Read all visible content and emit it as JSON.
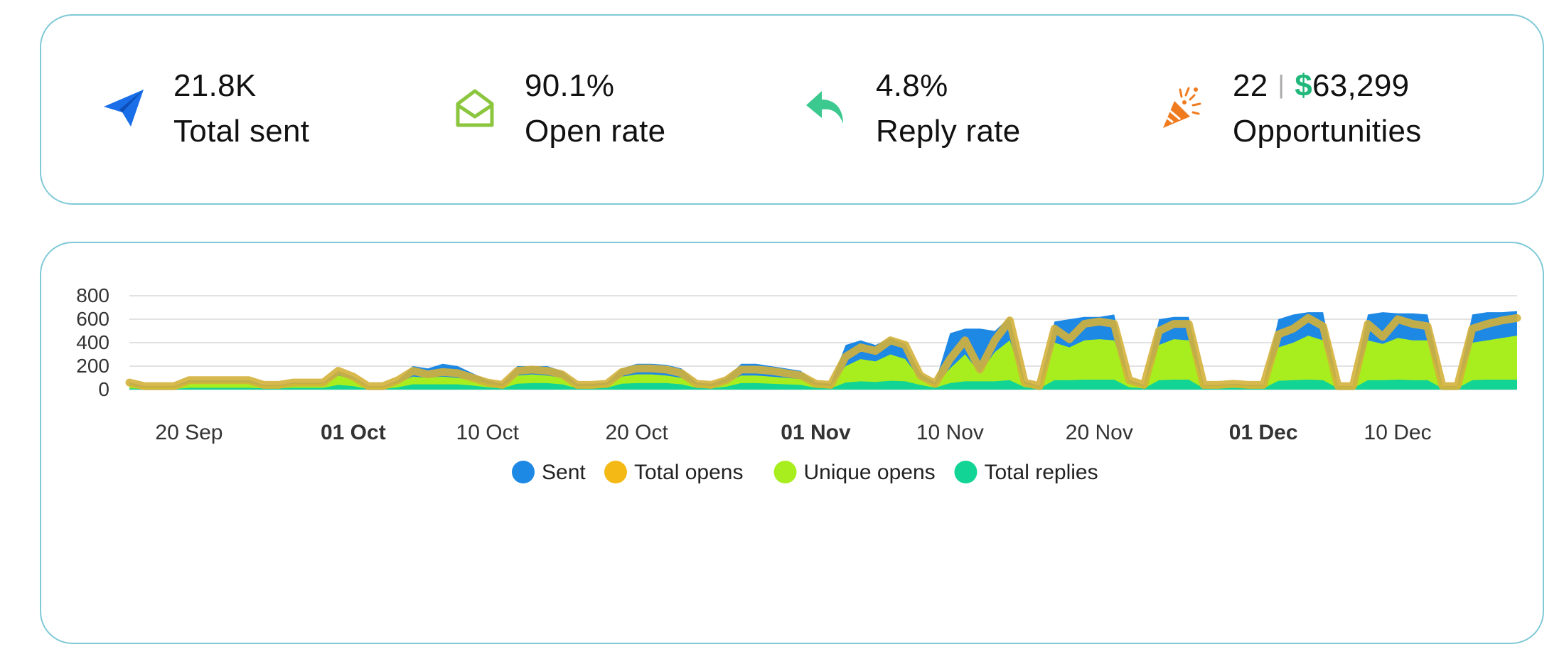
{
  "stats": [
    {
      "value": "21.8K",
      "label": "Total sent",
      "icon": "paper-plane-icon",
      "color": "#1a6fe8"
    },
    {
      "value": "90.1%",
      "label": "Open rate",
      "icon": "open-envelope-icon",
      "color": "#8cc63f"
    },
    {
      "value": "4.8%",
      "label": "Reply rate",
      "icon": "reply-arrow-icon",
      "color": "#3cc98f"
    },
    {
      "value_count": "22",
      "value_sep": "|",
      "value_currency": "$",
      "value_amount": "63,299",
      "label": "Opportunities",
      "icon": "party-popper-icon",
      "color": "#f07b1f"
    }
  ],
  "chart_data": {
    "type": "area",
    "x_ticks": [
      {
        "label": "20 Sep",
        "bold": false,
        "day": 4
      },
      {
        "label": "01 Oct",
        "bold": true,
        "day": 15
      },
      {
        "label": "10 Oct",
        "bold": false,
        "day": 24
      },
      {
        "label": "20 Oct",
        "bold": false,
        "day": 34
      },
      {
        "label": "01 Nov",
        "bold": true,
        "day": 46
      },
      {
        "label": "10 Nov",
        "bold": false,
        "day": 55
      },
      {
        "label": "20 Nov",
        "bold": false,
        "day": 65
      },
      {
        "label": "01 Dec",
        "bold": true,
        "day": 76
      },
      {
        "label": "10 Dec",
        "bold": false,
        "day": 85
      }
    ],
    "y_ticks": [
      "800",
      "600",
      "400",
      "200",
      "0"
    ],
    "ylim": [
      0,
      800
    ],
    "grid": true,
    "legend_position": "bottom",
    "series": [
      {
        "name": "Sent",
        "color": "#1e88e5",
        "values": [
          60,
          30,
          30,
          30,
          80,
          80,
          80,
          80,
          80,
          40,
          40,
          60,
          60,
          60,
          160,
          110,
          30,
          30,
          80,
          200,
          180,
          220,
          200,
          140,
          80,
          50,
          200,
          200,
          200,
          160,
          50,
          50,
          60,
          180,
          220,
          220,
          210,
          180,
          60,
          50,
          100,
          220,
          220,
          200,
          180,
          160,
          60,
          50,
          380,
          420,
          380,
          440,
          390,
          140,
          60,
          480,
          520,
          520,
          500,
          620,
          70,
          30,
          580,
          600,
          620,
          620,
          640,
          80,
          40,
          600,
          620,
          620,
          40,
          40,
          50,
          40,
          40,
          600,
          640,
          660,
          660,
          30,
          30,
          640,
          660,
          650,
          650,
          640,
          30,
          30,
          640,
          660,
          660,
          670
        ]
      },
      {
        "name": "Total opens",
        "color": "#f5b915",
        "values": [
          60,
          30,
          30,
          30,
          80,
          80,
          80,
          80,
          80,
          40,
          40,
          60,
          60,
          60,
          160,
          110,
          30,
          30,
          80,
          160,
          130,
          150,
          140,
          100,
          60,
          40,
          160,
          170,
          160,
          130,
          40,
          40,
          50,
          150,
          180,
          180,
          170,
          140,
          50,
          40,
          80,
          170,
          170,
          160,
          140,
          120,
          50,
          40,
          280,
          360,
          330,
          420,
          380,
          120,
          50,
          260,
          420,
          170,
          420,
          590,
          60,
          30,
          520,
          430,
          560,
          580,
          560,
          80,
          40,
          500,
          560,
          560,
          40,
          40,
          50,
          40,
          40,
          470,
          520,
          610,
          540,
          30,
          30,
          560,
          450,
          600,
          560,
          540,
          30,
          30,
          520,
          560,
          590,
          610
        ]
      },
      {
        "name": "Unique opens",
        "color": "#a8ee1f",
        "values": [
          40,
          20,
          20,
          20,
          60,
          60,
          60,
          60,
          60,
          30,
          30,
          50,
          50,
          50,
          120,
          90,
          20,
          20,
          60,
          110,
          100,
          110,
          100,
          80,
          50,
          30,
          120,
          130,
          120,
          100,
          30,
          30,
          40,
          110,
          130,
          130,
          120,
          100,
          40,
          30,
          60,
          120,
          120,
          110,
          100,
          90,
          40,
          30,
          200,
          260,
          240,
          300,
          260,
          90,
          40,
          180,
          300,
          140,
          320,
          420,
          50,
          20,
          400,
          360,
          420,
          430,
          420,
          60,
          30,
          380,
          430,
          420,
          30,
          30,
          40,
          30,
          30,
          360,
          400,
          460,
          420,
          20,
          20,
          420,
          390,
          440,
          420,
          420,
          20,
          20,
          400,
          420,
          440,
          460
        ]
      },
      {
        "name": "Total replies",
        "color": "#12d495",
        "values": [
          10,
          5,
          5,
          5,
          15,
          15,
          15,
          15,
          15,
          10,
          10,
          15,
          15,
          15,
          40,
          30,
          5,
          5,
          20,
          45,
          45,
          45,
          45,
          35,
          20,
          10,
          50,
          55,
          55,
          45,
          10,
          10,
          15,
          50,
          55,
          55,
          55,
          45,
          15,
          10,
          25,
          55,
          55,
          50,
          45,
          40,
          15,
          10,
          60,
          70,
          65,
          75,
          70,
          40,
          15,
          55,
          70,
          70,
          70,
          80,
          20,
          10,
          80,
          80,
          85,
          85,
          85,
          20,
          10,
          80,
          85,
          85,
          10,
          10,
          15,
          10,
          10,
          75,
          80,
          85,
          80,
          10,
          10,
          80,
          80,
          85,
          80,
          80,
          10,
          10,
          80,
          85,
          85,
          85
        ]
      }
    ]
  }
}
